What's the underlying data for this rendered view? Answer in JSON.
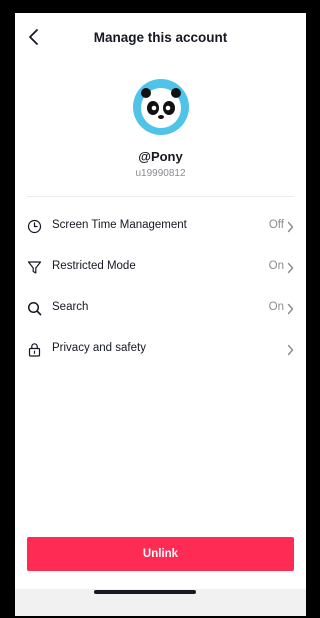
{
  "header": {
    "title": "Manage this account"
  },
  "profile": {
    "username": "@Pony",
    "user_id": "u19990812"
  },
  "settings": [
    {
      "label": "Screen Time Management",
      "value": "Off",
      "icon": "clock-icon"
    },
    {
      "label": "Restricted Mode",
      "value": "On",
      "icon": "filter-icon"
    },
    {
      "label": "Search",
      "value": "On",
      "icon": "search-icon"
    },
    {
      "label": "Privacy and safety",
      "value": "",
      "icon": "lock-icon"
    }
  ],
  "actions": {
    "unlink_label": "Unlink"
  },
  "colors": {
    "accent": "#fe2c55",
    "avatar_bg": "#4fc3e8",
    "text": "#161823",
    "muted": "#8a8b91"
  }
}
